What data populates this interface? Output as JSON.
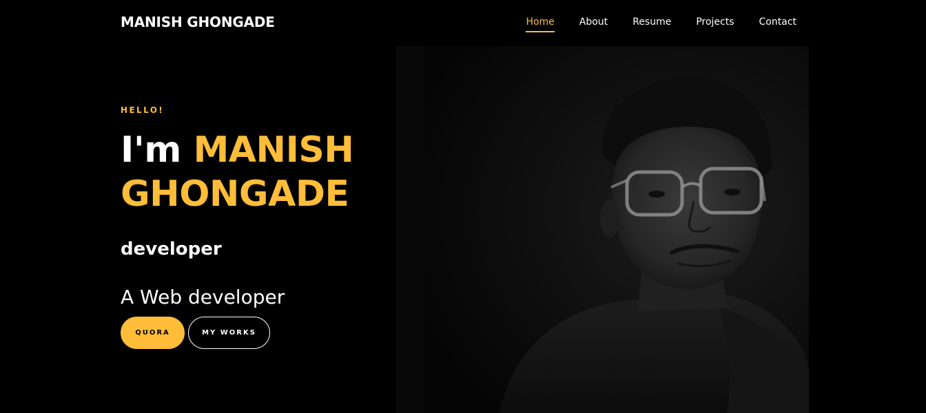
{
  "brand": "MANISH GHONGADE",
  "nav": {
    "items": [
      {
        "label": "Home",
        "active": true
      },
      {
        "label": "About",
        "active": false
      },
      {
        "label": "Resume",
        "active": false
      },
      {
        "label": "Projects",
        "active": false
      },
      {
        "label": "Contact",
        "active": false
      }
    ]
  },
  "hero": {
    "greeting": "HELLO!",
    "intro": "I'm",
    "name_line1": "MANISH",
    "name_line2": "GHONGADE",
    "role": "developer",
    "tagline": "A Web developer",
    "buttons": {
      "primary": "QUORA",
      "secondary": "MY WORKS"
    }
  },
  "colors": {
    "accent": "#ffbd39",
    "background": "#000000",
    "text": "#ffffff"
  }
}
